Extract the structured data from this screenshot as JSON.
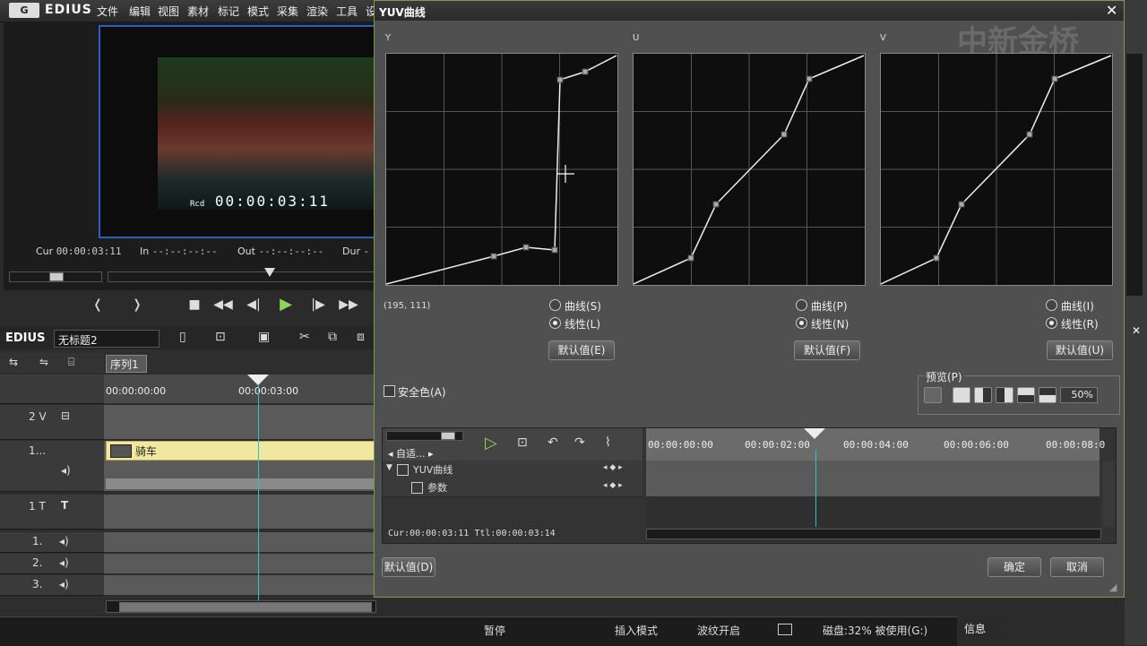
{
  "app": {
    "logo": "G",
    "brand": "EDIUS",
    "menu": [
      "文件",
      "编辑",
      "视图",
      "素材",
      "标记",
      "模式",
      "采集",
      "渲染",
      "工具",
      "设"
    ]
  },
  "preview": {
    "rcd_label": "Rcd",
    "timecode": "00:00:03:11",
    "cur_label": "Cur",
    "cur_value": "00:00:03:11",
    "in_label": "In",
    "in_value": "--:--:--:--",
    "out_label": "Out",
    "out_value": "--:--:--:--",
    "dur_label": "Dur",
    "dur_value": "-"
  },
  "timeline": {
    "brand": "EDIUS",
    "project_name": "无标题2",
    "sequence_tab": "序列1",
    "ruler": [
      "00:00:00:00",
      "00:00:03:00"
    ],
    "tracks": [
      {
        "name": "2 V"
      },
      {
        "name": "1..."
      },
      {
        "name": "1 T"
      },
      {
        "name": "1."
      },
      {
        "name": "2."
      },
      {
        "name": "3."
      }
    ],
    "clip_name": "骑车"
  },
  "dialog": {
    "title": "YUV曲线",
    "close": "✕",
    "watermark": "中新金桥",
    "coord_readout": "(195, 111)",
    "plots": [
      {
        "label": "Y",
        "radio_curve": "曲线(S)",
        "radio_linear": "线性(L)",
        "default_btn": "默认值(E)",
        "selected": "linear"
      },
      {
        "label": "U",
        "radio_curve": "曲线(P)",
        "radio_linear": "线性(N)",
        "default_btn": "默认值(F)",
        "selected": "linear"
      },
      {
        "label": "V",
        "radio_curve": "曲线(I)",
        "radio_linear": "线性(R)",
        "default_btn": "默认值(U)",
        "selected": "linear"
      }
    ],
    "safe_color_label": "安全色(A)",
    "preview_group_label": "预览(P)",
    "zoom_value": "50%",
    "keyframe": {
      "auto_label": "自适...",
      "ruler": [
        "00:00:00:00",
        "00:00:02:00",
        "00:00:04:00",
        "00:00:06:00",
        "00:00:08:0"
      ],
      "rows": [
        "YUV曲线",
        "参数"
      ],
      "cur": "Cur:00:00:03:11",
      "ttl": "Ttl:00:00:03:14"
    },
    "default_btn": "默认值(D)",
    "ok_btn": "确定",
    "cancel_btn": "取消"
  },
  "status": {
    "paused": "暂停",
    "insert_mode": "插入模式",
    "ripple_on": "波纹开启",
    "disk": "磁盘:32% 被使用(G:)"
  },
  "side_panel": {
    "info_tab": "信息"
  }
}
